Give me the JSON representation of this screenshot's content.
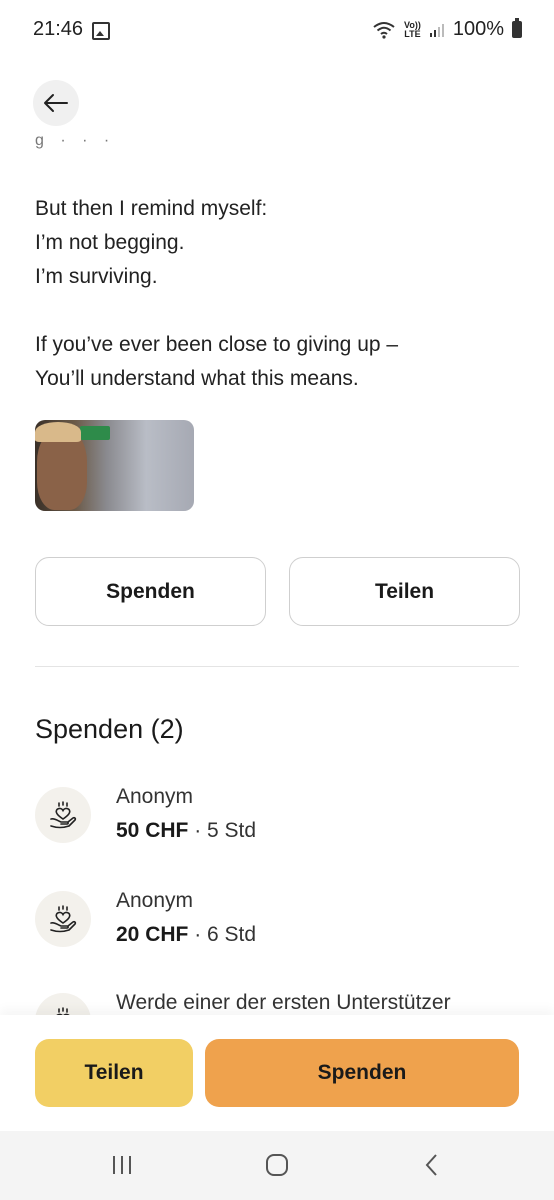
{
  "status_bar": {
    "time": "21:46",
    "battery": "100%",
    "network_top": "Vo))",
    "network_bottom": "LTE"
  },
  "icons": {
    "back": "arrow-left-icon",
    "donation": "heart-hand-icon",
    "gallery": "image-icon",
    "wifi": "wifi-icon",
    "signal": "signal-icon",
    "battery": "battery-icon"
  },
  "story": {
    "truncated_line": "g · · ·",
    "lines_block1": [
      "But then I remind myself:",
      "I’m not begging.",
      "I’m surviving."
    ],
    "lines_block2": [
      "If you’ve ever been close to giving up –",
      "You’ll understand what this means."
    ]
  },
  "actions": {
    "donate_label": "Spenden",
    "share_label": "Teilen"
  },
  "donations": {
    "title": "Spenden (2)",
    "items": [
      {
        "name": "Anonym",
        "amount": "50 CHF",
        "time": " · 5 Std"
      },
      {
        "name": "Anonym",
        "amount": "20 CHF",
        "time": " · 6 Std"
      }
    ],
    "cta": "Werde einer der ersten Unterstützer"
  },
  "bottom_bar": {
    "share_label": "Teilen",
    "donate_label": "Spenden"
  },
  "colors": {
    "share_button": "#f2cf64",
    "donate_button": "#efa24d"
  }
}
